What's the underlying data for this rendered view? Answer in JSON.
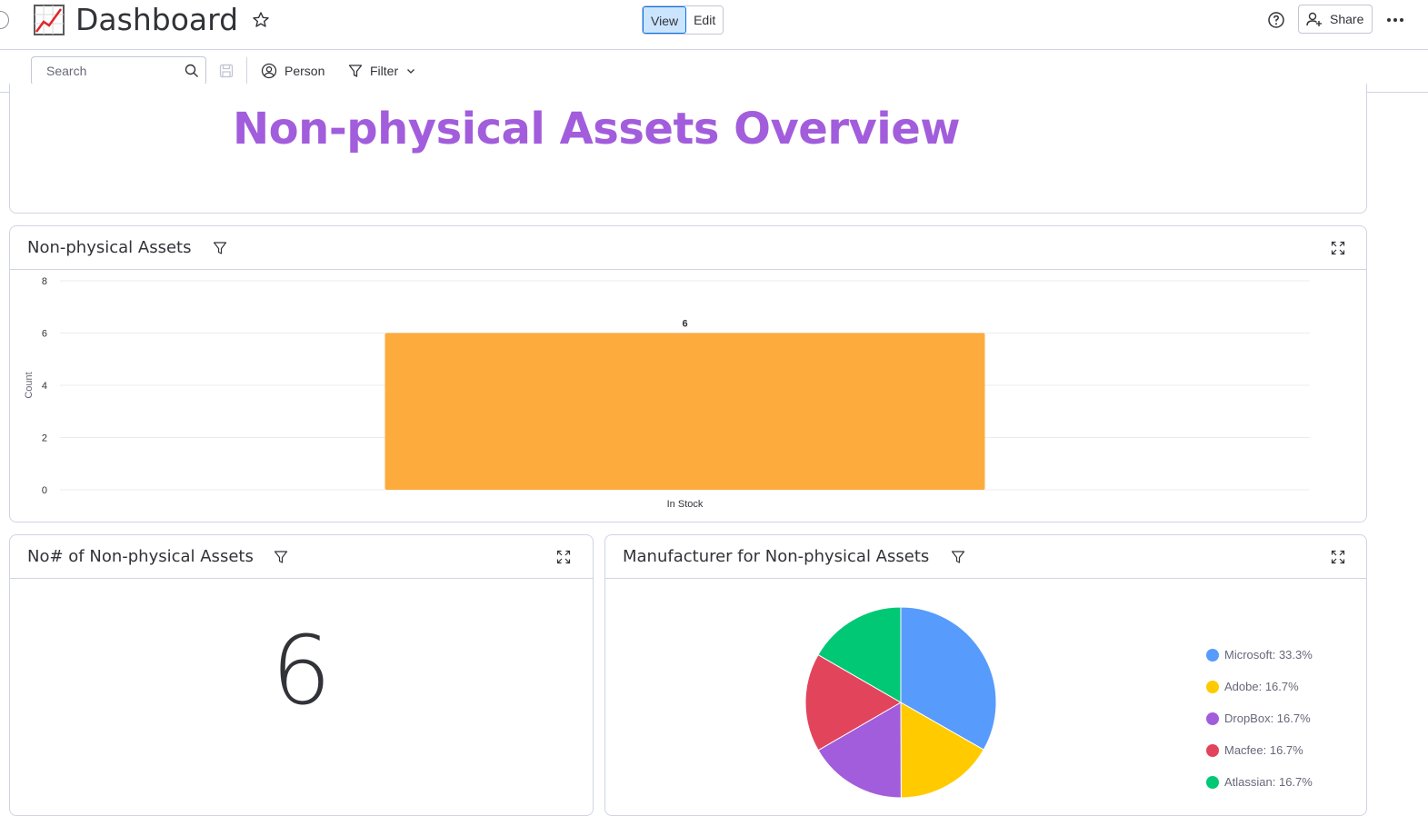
{
  "header": {
    "title": "Dashboard",
    "view_label": "View",
    "edit_label": "Edit",
    "share_label": "Share"
  },
  "toolbar": {
    "search_placeholder": "Search",
    "person_label": "Person",
    "filter_label": "Filter"
  },
  "overview": {
    "title": "Non-physical Assets Overview"
  },
  "bar_widget": {
    "title": "Non-physical Assets"
  },
  "number_widget": {
    "title": "No# of Non-physical Assets",
    "value": "6"
  },
  "pie_widget": {
    "title": "Manufacturer for Non-physical Assets"
  },
  "colors": {
    "accent": "#0073ea",
    "title_purple": "#a25ddc",
    "bar_orange": "#fdab3d"
  },
  "chart_data": [
    {
      "type": "bar",
      "categories": [
        "In Stock"
      ],
      "values": [
        6
      ],
      "ylabel": "Count",
      "ylim": [
        0,
        8
      ],
      "yticks": [
        0,
        2,
        4,
        6,
        8
      ],
      "grid": true,
      "color": "#fdab3d"
    },
    {
      "type": "pie",
      "legend_position": "right",
      "slices": [
        {
          "label": "Microsoft: 33.3%",
          "value": 33.3,
          "color": "#579bfc"
        },
        {
          "label": "Adobe: 16.7%",
          "value": 16.7,
          "color": "#ffcb00"
        },
        {
          "label": "DropBox: 16.7%",
          "value": 16.7,
          "color": "#a25ddc"
        },
        {
          "label": "Macfee: 16.7%",
          "value": 16.7,
          "color": "#e2445c"
        },
        {
          "label": "Atlassian: 16.7%",
          "value": 16.7,
          "color": "#00c875"
        }
      ]
    }
  ]
}
